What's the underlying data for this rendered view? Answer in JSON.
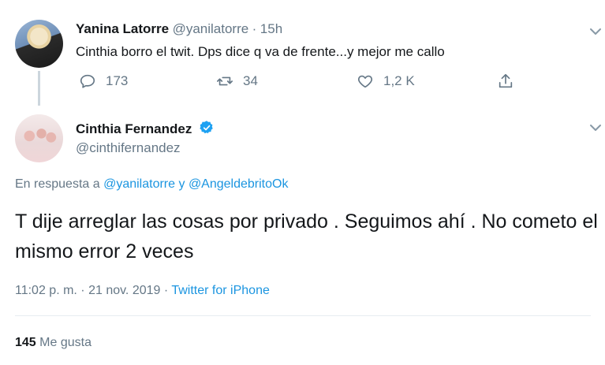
{
  "reply_tweet": {
    "name": "Yanina Latorre",
    "handle": "@yanilatorre",
    "separator": "·",
    "time": "15h",
    "text": "Cinthia borro el twit. Dps dice q va de frente...y mejor me callo",
    "replies": "173",
    "retweets": "34",
    "likes": "1,2 K"
  },
  "main_tweet": {
    "name": "Cinthia Fernandez",
    "handle": "@cinthifernandez",
    "reply_prefix": "En respuesta a",
    "reply_user_1": "@yanilatorre",
    "reply_conj": "y",
    "reply_user_2": "@AngeldebritoOk",
    "text": "T dije arreglar las cosas por privado . Seguimos ahí . No cometo el mismo error 2 veces",
    "timestamp": "11:02 p. m. · 21 nov. 2019",
    "meta_separator": "·",
    "source": "Twitter for iPhone",
    "like_count": "145",
    "like_label": "Me gusta"
  },
  "colors": {
    "accent": "#1b95e0",
    "secondary_text": "#657786",
    "divider": "#e6ecf0"
  },
  "icons": [
    "reply-icon",
    "retweet-icon",
    "like-icon",
    "share-icon",
    "chevron-down-icon",
    "verified-badge-icon"
  ]
}
